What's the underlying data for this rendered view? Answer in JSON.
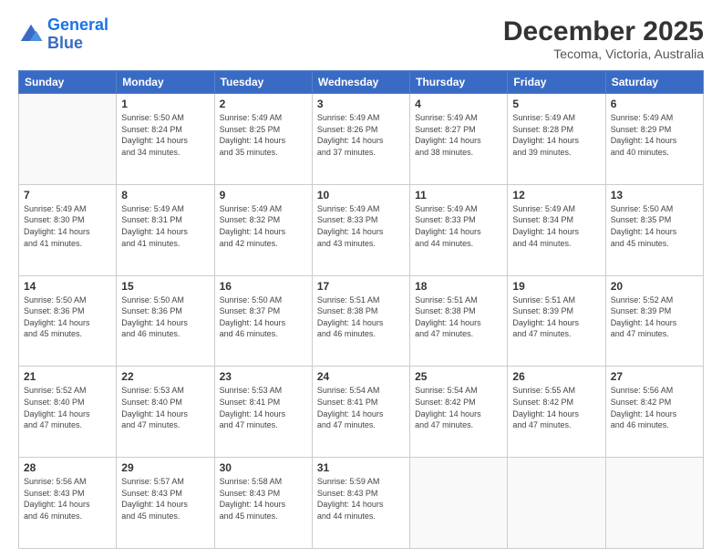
{
  "logo": {
    "line1": "General",
    "line2": "Blue"
  },
  "header": {
    "month_title": "December 2025",
    "subtitle": "Tecoma, Victoria, Australia"
  },
  "weekdays": [
    "Sunday",
    "Monday",
    "Tuesday",
    "Wednesday",
    "Thursday",
    "Friday",
    "Saturday"
  ],
  "weeks": [
    [
      {
        "day": "",
        "info": ""
      },
      {
        "day": "1",
        "info": "Sunrise: 5:50 AM\nSunset: 8:24 PM\nDaylight: 14 hours\nand 34 minutes."
      },
      {
        "day": "2",
        "info": "Sunrise: 5:49 AM\nSunset: 8:25 PM\nDaylight: 14 hours\nand 35 minutes."
      },
      {
        "day": "3",
        "info": "Sunrise: 5:49 AM\nSunset: 8:26 PM\nDaylight: 14 hours\nand 37 minutes."
      },
      {
        "day": "4",
        "info": "Sunrise: 5:49 AM\nSunset: 8:27 PM\nDaylight: 14 hours\nand 38 minutes."
      },
      {
        "day": "5",
        "info": "Sunrise: 5:49 AM\nSunset: 8:28 PM\nDaylight: 14 hours\nand 39 minutes."
      },
      {
        "day": "6",
        "info": "Sunrise: 5:49 AM\nSunset: 8:29 PM\nDaylight: 14 hours\nand 40 minutes."
      }
    ],
    [
      {
        "day": "7",
        "info": "Sunrise: 5:49 AM\nSunset: 8:30 PM\nDaylight: 14 hours\nand 41 minutes."
      },
      {
        "day": "8",
        "info": "Sunrise: 5:49 AM\nSunset: 8:31 PM\nDaylight: 14 hours\nand 41 minutes."
      },
      {
        "day": "9",
        "info": "Sunrise: 5:49 AM\nSunset: 8:32 PM\nDaylight: 14 hours\nand 42 minutes."
      },
      {
        "day": "10",
        "info": "Sunrise: 5:49 AM\nSunset: 8:33 PM\nDaylight: 14 hours\nand 43 minutes."
      },
      {
        "day": "11",
        "info": "Sunrise: 5:49 AM\nSunset: 8:33 PM\nDaylight: 14 hours\nand 44 minutes."
      },
      {
        "day": "12",
        "info": "Sunrise: 5:49 AM\nSunset: 8:34 PM\nDaylight: 14 hours\nand 44 minutes."
      },
      {
        "day": "13",
        "info": "Sunrise: 5:50 AM\nSunset: 8:35 PM\nDaylight: 14 hours\nand 45 minutes."
      }
    ],
    [
      {
        "day": "14",
        "info": "Sunrise: 5:50 AM\nSunset: 8:36 PM\nDaylight: 14 hours\nand 45 minutes."
      },
      {
        "day": "15",
        "info": "Sunrise: 5:50 AM\nSunset: 8:36 PM\nDaylight: 14 hours\nand 46 minutes."
      },
      {
        "day": "16",
        "info": "Sunrise: 5:50 AM\nSunset: 8:37 PM\nDaylight: 14 hours\nand 46 minutes."
      },
      {
        "day": "17",
        "info": "Sunrise: 5:51 AM\nSunset: 8:38 PM\nDaylight: 14 hours\nand 46 minutes."
      },
      {
        "day": "18",
        "info": "Sunrise: 5:51 AM\nSunset: 8:38 PM\nDaylight: 14 hours\nand 47 minutes."
      },
      {
        "day": "19",
        "info": "Sunrise: 5:51 AM\nSunset: 8:39 PM\nDaylight: 14 hours\nand 47 minutes."
      },
      {
        "day": "20",
        "info": "Sunrise: 5:52 AM\nSunset: 8:39 PM\nDaylight: 14 hours\nand 47 minutes."
      }
    ],
    [
      {
        "day": "21",
        "info": "Sunrise: 5:52 AM\nSunset: 8:40 PM\nDaylight: 14 hours\nand 47 minutes."
      },
      {
        "day": "22",
        "info": "Sunrise: 5:53 AM\nSunset: 8:40 PM\nDaylight: 14 hours\nand 47 minutes."
      },
      {
        "day": "23",
        "info": "Sunrise: 5:53 AM\nSunset: 8:41 PM\nDaylight: 14 hours\nand 47 minutes."
      },
      {
        "day": "24",
        "info": "Sunrise: 5:54 AM\nSunset: 8:41 PM\nDaylight: 14 hours\nand 47 minutes."
      },
      {
        "day": "25",
        "info": "Sunrise: 5:54 AM\nSunset: 8:42 PM\nDaylight: 14 hours\nand 47 minutes."
      },
      {
        "day": "26",
        "info": "Sunrise: 5:55 AM\nSunset: 8:42 PM\nDaylight: 14 hours\nand 47 minutes."
      },
      {
        "day": "27",
        "info": "Sunrise: 5:56 AM\nSunset: 8:42 PM\nDaylight: 14 hours\nand 46 minutes."
      }
    ],
    [
      {
        "day": "28",
        "info": "Sunrise: 5:56 AM\nSunset: 8:43 PM\nDaylight: 14 hours\nand 46 minutes."
      },
      {
        "day": "29",
        "info": "Sunrise: 5:57 AM\nSunset: 8:43 PM\nDaylight: 14 hours\nand 45 minutes."
      },
      {
        "day": "30",
        "info": "Sunrise: 5:58 AM\nSunset: 8:43 PM\nDaylight: 14 hours\nand 45 minutes."
      },
      {
        "day": "31",
        "info": "Sunrise: 5:59 AM\nSunset: 8:43 PM\nDaylight: 14 hours\nand 44 minutes."
      },
      {
        "day": "",
        "info": ""
      },
      {
        "day": "",
        "info": ""
      },
      {
        "day": "",
        "info": ""
      }
    ]
  ]
}
